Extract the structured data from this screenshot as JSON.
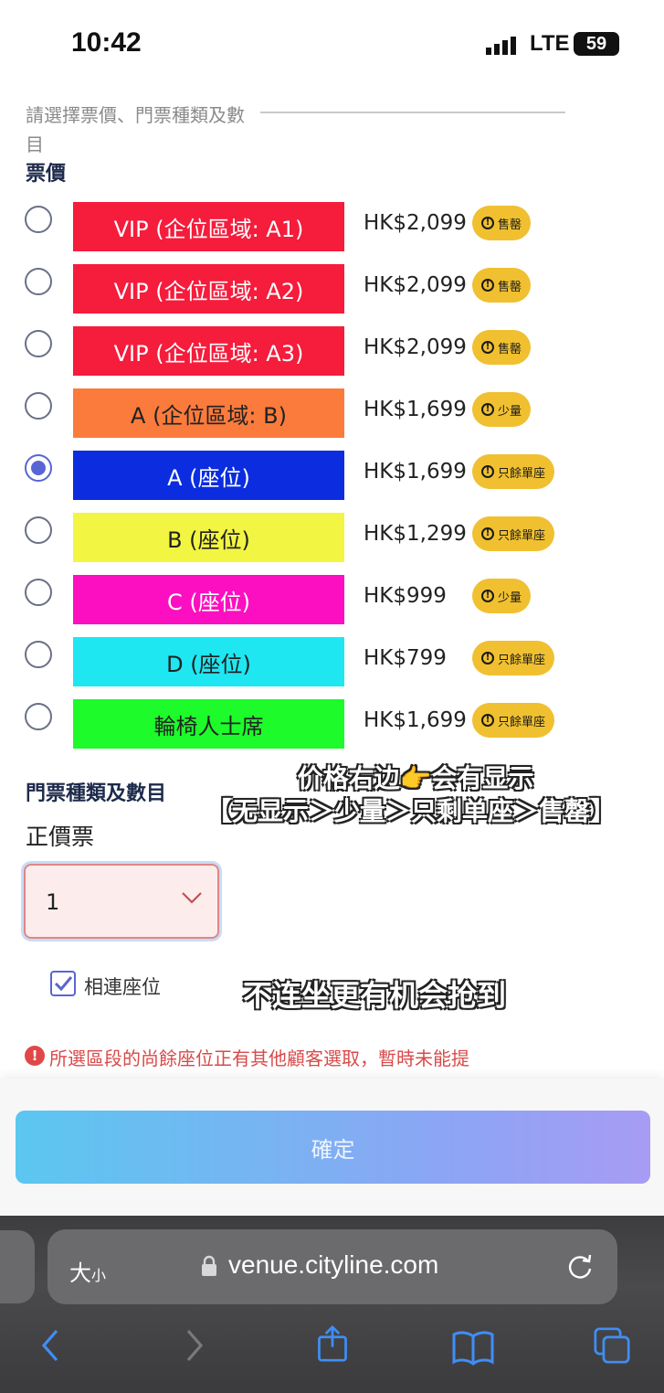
{
  "status_bar": {
    "time": "10:42",
    "network": "LTE",
    "battery": "59"
  },
  "form": {
    "hint": "請選擇票價、門票種類及數目",
    "price_section_title": "票價",
    "tickets": [
      {
        "label": "VIP (企位區域: A1)",
        "price": "HK$2,099",
        "status": "售罄",
        "color": "#f51c3c",
        "text_color": "#ffffff",
        "selected": false
      },
      {
        "label": "VIP (企位區域: A2)",
        "price": "HK$2,099",
        "status": "售罄",
        "color": "#f51c3c",
        "text_color": "#ffffff",
        "selected": false
      },
      {
        "label": "VIP (企位區域: A3)",
        "price": "HK$2,099",
        "status": "售罄",
        "color": "#f51c3c",
        "text_color": "#ffffff",
        "selected": false
      },
      {
        "label": "A (企位區域: B)",
        "price": "HK$1,699",
        "status": "少量",
        "color": "#fb7b3c",
        "text_color": "#222222",
        "selected": false
      },
      {
        "label": "A (座位)",
        "price": "HK$1,699",
        "status": "只餘單座",
        "color": "#0b2ddf",
        "text_color": "#ffffff",
        "selected": true
      },
      {
        "label": "B (座位)",
        "price": "HK$1,299",
        "status": "只餘單座",
        "color": "#f2f542",
        "text_color": "#222222",
        "selected": false
      },
      {
        "label": "C (座位)",
        "price": "HK$999",
        "status": "少量",
        "color": "#fc0fc0",
        "text_color": "#ffffff",
        "selected": false
      },
      {
        "label": "D (座位)",
        "price": "HK$799",
        "status": "只餘單座",
        "color": "#1ee7f2",
        "text_color": "#222222",
        "selected": false
      },
      {
        "label": "輪椅人士席",
        "price": "HK$1,699",
        "status": "只餘單座",
        "color": "#1dfb2a",
        "text_color": "#222222",
        "selected": false
      }
    ],
    "ticket_type_section_title": "門票種類及數目",
    "ticket_type_label": "正價票",
    "quantity_value": "1",
    "adjacent_seats_label": "相連座位",
    "adjacent_seats_checked": true,
    "error_message": "所選區段的尚餘座位正有其他顧客選取，暫時未能提供所選的座位",
    "confirm_label": "確定"
  },
  "overlay_captions": {
    "line1": "价格右边👉会有显示",
    "line2": "【无显示＞少量＞只剩单座＞售罄】",
    "line3": "不连坐更有机会抢到"
  },
  "browser": {
    "text_size_label": "大",
    "text_size_small": "小",
    "url": "venue.cityline.com"
  },
  "icons": {
    "back": "chevron-left-icon",
    "forward": "chevron-right-icon",
    "share": "share-icon",
    "bookmarks": "book-icon",
    "tabs": "tabs-icon"
  }
}
